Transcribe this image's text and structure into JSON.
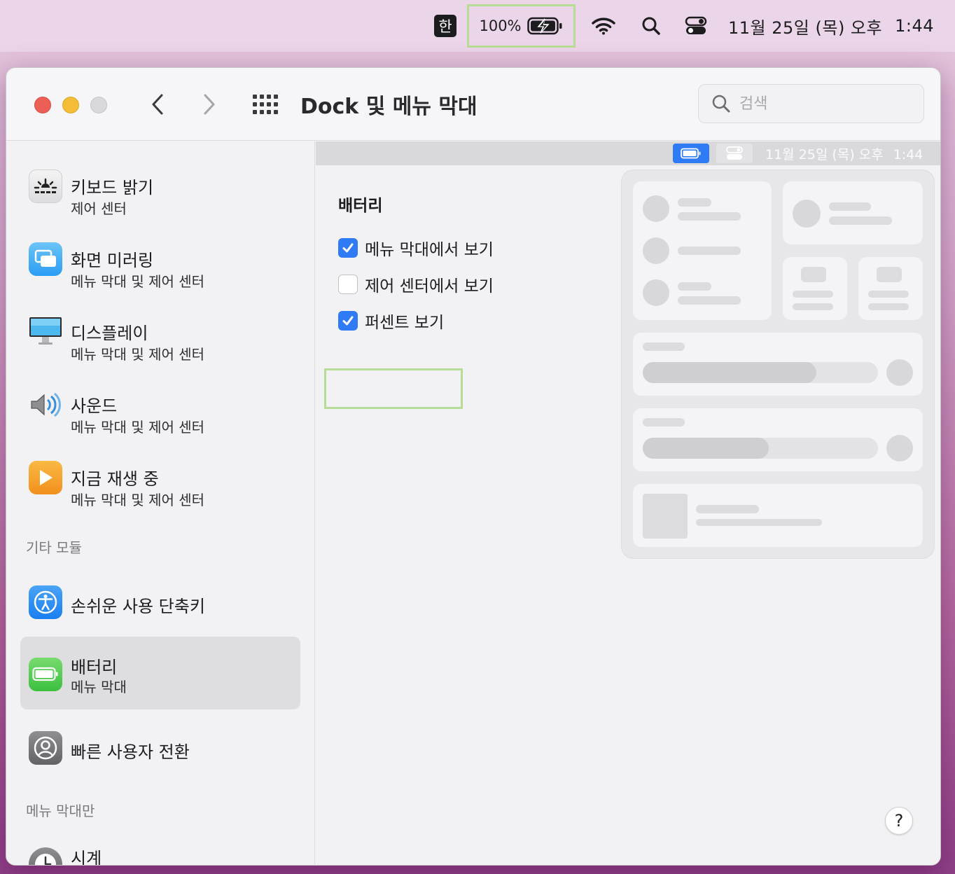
{
  "menubar": {
    "input_method": "한",
    "battery_percent": "100%",
    "date": "11월 25일 (목) 오후",
    "time": "1:44",
    "icons": [
      "battery-charging-icon",
      "wifi-icon",
      "search-icon",
      "control-center-icon"
    ]
  },
  "window": {
    "title": "Dock 및 메뉴 막대",
    "search_placeholder": "검색"
  },
  "sidebar": {
    "items": [
      {
        "title": "키보드 밝기",
        "subtitle": "제어 센터",
        "icon": "keyboard-brightness-icon"
      },
      {
        "title": "화면 미러링",
        "subtitle": "메뉴 막대 및 제어 센터",
        "icon": "screen-mirroring-icon"
      },
      {
        "title": "디스플레이",
        "subtitle": "메뉴 막대 및 제어 센터",
        "icon": "display-icon"
      },
      {
        "title": "사운드",
        "subtitle": "메뉴 막대 및 제어 센터",
        "icon": "sound-icon"
      },
      {
        "title": "지금 재생 중",
        "subtitle": "메뉴 막대 및 제어 센터",
        "icon": "now-playing-icon"
      }
    ],
    "section_other": "기타 모듈",
    "other_items": [
      {
        "title": "손쉬운 사용 단축키",
        "icon": "accessibility-icon"
      },
      {
        "title": "배터리",
        "subtitle": "메뉴 막대",
        "icon": "battery-icon",
        "selected": true
      },
      {
        "title": "빠른 사용자 전환",
        "icon": "user-switch-icon"
      }
    ],
    "section_menubar_only": "메뉴 막대만",
    "menubar_only_items": [
      {
        "title": "시계",
        "icon": "clock-icon"
      }
    ]
  },
  "content": {
    "preview": {
      "date": "11월 25일 (목) 오후",
      "time": "1:44"
    },
    "heading": "배터리",
    "options": [
      {
        "label": "메뉴 막대에서 보기",
        "checked": true
      },
      {
        "label": "제어 센터에서 보기",
        "checked": false
      },
      {
        "label": "퍼센트 보기",
        "checked": true
      }
    ],
    "help_label": "?"
  },
  "colors": {
    "accent": "#2f7bf5",
    "highlight": "#b7dc95",
    "battery_green": "#5ac85a"
  }
}
